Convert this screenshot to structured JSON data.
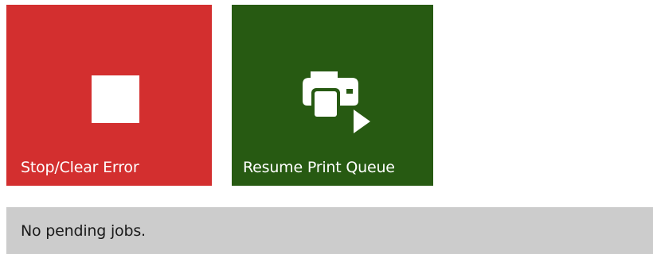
{
  "tiles": {
    "stop": {
      "label": "Stop/Clear Error",
      "icon": "stop-icon",
      "color": "#d32f2f"
    },
    "resume": {
      "label": "Resume Print Queue",
      "icon": "printer-resume-icon",
      "color": "#275a12"
    }
  },
  "status": {
    "text": "No pending jobs.",
    "background": "#cccccc"
  }
}
